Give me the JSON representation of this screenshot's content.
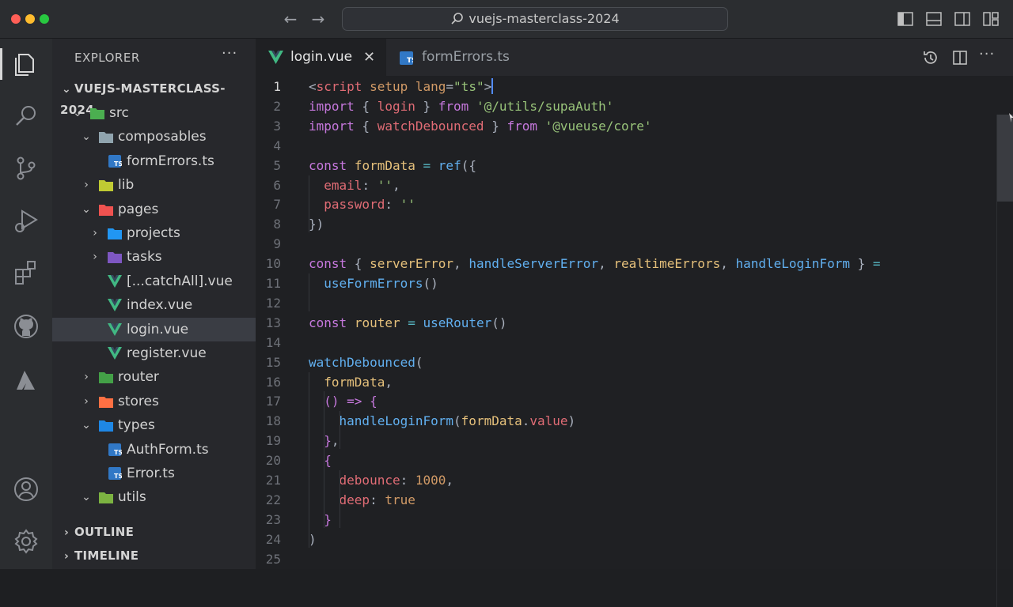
{
  "titlebar": {
    "search_text": "vuejs-masterclass-2024",
    "back_icon": "arrow-left-icon",
    "forward_icon": "arrow-right-icon"
  },
  "colors": {
    "accent": "#528bff",
    "vue_green": "#41b883",
    "ts_blue": "#3178c6"
  },
  "activity_bar": {
    "items": [
      "explorer-icon",
      "search-icon",
      "source-control-icon",
      "run-debug-icon",
      "extensions-icon",
      "github-icon",
      "azure-icon"
    ],
    "bottom": [
      "account-icon",
      "settings-gear-icon"
    ]
  },
  "sidebar": {
    "title": "EXPLORER",
    "more": "···",
    "root": "VUEJS-MASTERCLASS-2024",
    "tree": [
      {
        "label": "src",
        "depth": 1,
        "type": "folder",
        "open": true,
        "icon": "src-folder-icon"
      },
      {
        "label": "composables",
        "depth": 2,
        "type": "folder",
        "open": true,
        "icon": "folder-icon"
      },
      {
        "label": "formErrors.ts",
        "depth": 3,
        "type": "ts",
        "icon": "typescript-file-icon"
      },
      {
        "label": "lib",
        "depth": 2,
        "type": "folder",
        "open": false,
        "icon": "lib-folder-icon"
      },
      {
        "label": "pages",
        "depth": 2,
        "type": "folder",
        "open": true,
        "icon": "pages-folder-icon"
      },
      {
        "label": "projects",
        "depth": 3,
        "type": "folder",
        "open": false,
        "icon": "projects-folder-icon"
      },
      {
        "label": "tasks",
        "depth": 3,
        "type": "folder",
        "open": false,
        "icon": "tasks-folder-icon"
      },
      {
        "label": "[...catchAll].vue",
        "depth": 3,
        "type": "vue",
        "icon": "vue-file-icon"
      },
      {
        "label": "index.vue",
        "depth": 3,
        "type": "vue",
        "icon": "vue-file-icon"
      },
      {
        "label": "login.vue",
        "depth": 3,
        "type": "vue",
        "icon": "vue-file-icon",
        "selected": true
      },
      {
        "label": "register.vue",
        "depth": 3,
        "type": "vue",
        "icon": "vue-file-icon"
      },
      {
        "label": "router",
        "depth": 2,
        "type": "folder",
        "open": false,
        "icon": "router-folder-icon"
      },
      {
        "label": "stores",
        "depth": 2,
        "type": "folder",
        "open": false,
        "icon": "stores-folder-icon"
      },
      {
        "label": "types",
        "depth": 2,
        "type": "folder",
        "open": true,
        "icon": "types-folder-icon"
      },
      {
        "label": "AuthForm.ts",
        "depth": 3,
        "type": "ts",
        "icon": "typescript-file-icon"
      },
      {
        "label": "Error.ts",
        "depth": 3,
        "type": "ts",
        "icon": "typescript-file-icon"
      },
      {
        "label": "utils",
        "depth": 2,
        "type": "folder",
        "open": true,
        "icon": "utils-folder-icon"
      }
    ],
    "outline": "OUTLINE",
    "timeline": "TIMELINE"
  },
  "tabs": [
    {
      "label": "login.vue",
      "active": true,
      "icon": "vue-file-icon",
      "close": "✕"
    },
    {
      "label": "formErrors.ts",
      "active": false,
      "icon": "typescript-file-icon"
    }
  ],
  "editor": {
    "current_line": 1,
    "lines": [
      [
        [
          "pl",
          "<"
        ],
        [
          "p",
          "script"
        ],
        [
          "a",
          " setup"
        ],
        [
          "a",
          " lang"
        ],
        [
          "pl",
          "="
        ],
        [
          "s",
          "\"ts\""
        ],
        [
          "pl",
          ">"
        ]
      ],
      [
        [
          "k",
          "import"
        ],
        [
          "pl",
          " { "
        ],
        [
          "p",
          "login"
        ],
        [
          "pl",
          " } "
        ],
        [
          "k",
          "from"
        ],
        [
          "pl",
          " "
        ],
        [
          "s",
          "'@/utils/supaAuth'"
        ]
      ],
      [
        [
          "k",
          "import"
        ],
        [
          "pl",
          " { "
        ],
        [
          "p",
          "watchDebounced"
        ],
        [
          "pl",
          " } "
        ],
        [
          "k",
          "from"
        ],
        [
          "pl",
          " "
        ],
        [
          "s",
          "'@vueuse/core'"
        ]
      ],
      [],
      [
        [
          "k",
          "const"
        ],
        [
          "pl",
          " "
        ],
        [
          "v",
          "formData"
        ],
        [
          "pl",
          " "
        ],
        [
          "o",
          "="
        ],
        [
          "pl",
          " "
        ],
        [
          "f",
          "ref"
        ],
        [
          "pl",
          "({"
        ]
      ],
      [
        [
          "pl",
          "  "
        ],
        [
          "p",
          "email"
        ],
        [
          "pl",
          ": "
        ],
        [
          "s",
          "''"
        ],
        [
          "pl",
          ","
        ]
      ],
      [
        [
          "pl",
          "  "
        ],
        [
          "p",
          "password"
        ],
        [
          "pl",
          ": "
        ],
        [
          "s",
          "''"
        ]
      ],
      [
        [
          "pl",
          "})"
        ]
      ],
      [],
      [
        [
          "k",
          "const"
        ],
        [
          "pl",
          " { "
        ],
        [
          "v",
          "serverError"
        ],
        [
          "pl",
          ", "
        ],
        [
          "f",
          "handleServerError"
        ],
        [
          "pl",
          ", "
        ],
        [
          "v",
          "realtimeErrors"
        ],
        [
          "pl",
          ", "
        ],
        [
          "f",
          "handleLoginForm"
        ],
        [
          "pl",
          " } "
        ],
        [
          "o",
          "="
        ]
      ],
      [
        [
          "pl",
          "  "
        ],
        [
          "f",
          "useFormErrors"
        ],
        [
          "pl",
          "()"
        ]
      ],
      [],
      [
        [
          "k",
          "const"
        ],
        [
          "pl",
          " "
        ],
        [
          "v",
          "router"
        ],
        [
          "pl",
          " "
        ],
        [
          "o",
          "="
        ],
        [
          "pl",
          " "
        ],
        [
          "f",
          "useRouter"
        ],
        [
          "pl",
          "()"
        ]
      ],
      [],
      [
        [
          "f",
          "watchDebounced"
        ],
        [
          "pl",
          "("
        ]
      ],
      [
        [
          "pl",
          "  "
        ],
        [
          "v",
          "formData"
        ],
        [
          "pl",
          ","
        ]
      ],
      [
        [
          "pl",
          "  "
        ],
        [
          "k",
          "()"
        ],
        [
          "pl",
          " "
        ],
        [
          "k",
          "=>"
        ],
        [
          "pl",
          " "
        ],
        [
          "k",
          "{"
        ]
      ],
      [
        [
          "pl",
          "    "
        ],
        [
          "f",
          "handleLoginForm"
        ],
        [
          "pl",
          "("
        ],
        [
          "v",
          "formData"
        ],
        [
          "pl",
          "."
        ],
        [
          "p",
          "value"
        ],
        [
          "pl",
          ")"
        ]
      ],
      [
        [
          "pl",
          "  "
        ],
        [
          "k",
          "}"
        ],
        [
          "pl",
          ","
        ]
      ],
      [
        [
          "pl",
          "  "
        ],
        [
          "k",
          "{"
        ]
      ],
      [
        [
          "pl",
          "    "
        ],
        [
          "p",
          "debounce"
        ],
        [
          "pl",
          ": "
        ],
        [
          "n",
          "1000"
        ],
        [
          "pl",
          ","
        ]
      ],
      [
        [
          "pl",
          "    "
        ],
        [
          "p",
          "deep"
        ],
        [
          "pl",
          ": "
        ],
        [
          "n",
          "true"
        ]
      ],
      [
        [
          "pl",
          "  "
        ],
        [
          "k",
          "}"
        ]
      ],
      [
        [
          "pl",
          ")"
        ]
      ],
      []
    ]
  }
}
